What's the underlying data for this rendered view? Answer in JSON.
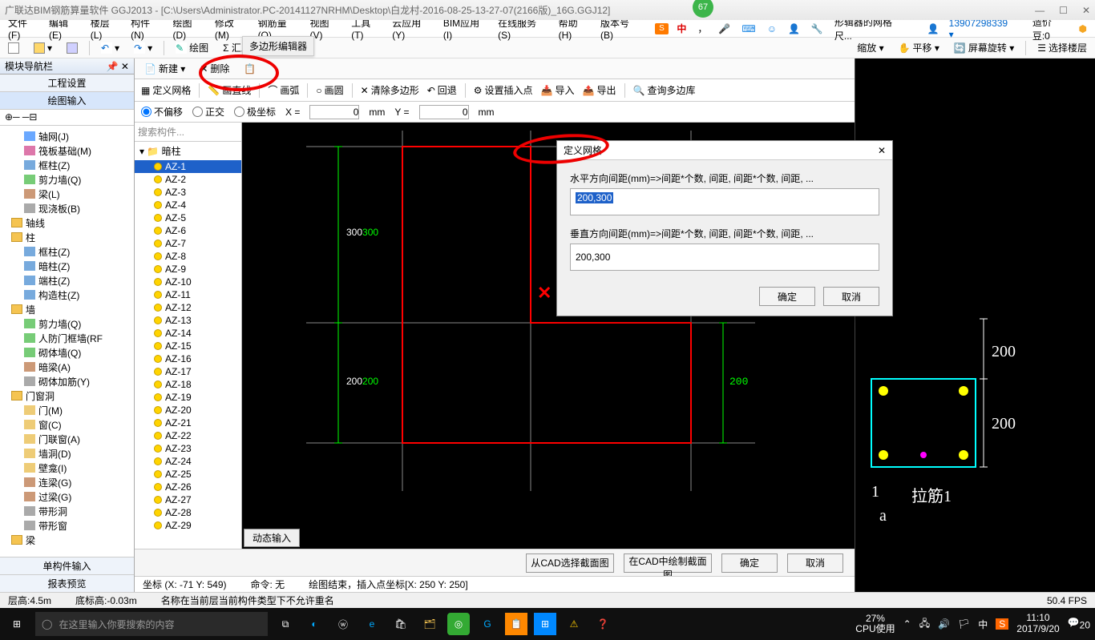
{
  "title": "广联达BIM钢筋算量软件 GGJ2013 - [C:\\Users\\Administrator.PC-20141127NRHM\\Desktop\\白龙村-2016-08-25-13-27-07(2166版)_16G.GGJ12]",
  "badge": "67",
  "winbtns": {
    "min": "—",
    "max": "☐",
    "close": "✕"
  },
  "menu": [
    "文件(F)",
    "编辑(E)",
    "楼层(L)",
    "构件(N)",
    "绘图(D)",
    "修改(M)",
    "钢筋量(Q)",
    "视图(V)",
    "工具(T)",
    "云应用(Y)",
    "BIM应用(I)",
    "在线服务(S)",
    "帮助(H)",
    "版本号(B)"
  ],
  "ime": {
    "s": "S",
    "cn": "中",
    "gridtip": "形辑器的网格尺..."
  },
  "user": "13907298339 ▾",
  "bean": "造价豆:0",
  "tb1": {
    "draw": "绘图",
    "sum": "Σ 汇总计算"
  },
  "tb1r": {
    "zoom": "缩放 ▾",
    "pan": "平移 ▾",
    "rot": "屏幕旋转 ▾",
    "sel": "选择楼层"
  },
  "nav": {
    "title": "模块导航栏",
    "seg1": "工程设置",
    "seg2": "绘图输入",
    "seg_bottom": [
      "单构件输入",
      "报表预览"
    ],
    "items": [
      {
        "t": "轴网(J)",
        "c": "ic-grid",
        "p": 2
      },
      {
        "t": "筏板基础(M)",
        "c": "ic-base",
        "p": 2
      },
      {
        "t": "框柱(Z)",
        "c": "ic-col",
        "p": 2
      },
      {
        "t": "剪力墙(Q)",
        "c": "ic-wall",
        "p": 2
      },
      {
        "t": "梁(L)",
        "c": "ic-beam",
        "p": 2
      },
      {
        "t": "现浇板(B)",
        "c": "ic-gen",
        "p": 2
      },
      {
        "t": "轴线",
        "c": "ic-folder",
        "p": 1
      },
      {
        "t": "柱",
        "c": "ic-folder",
        "p": 1
      },
      {
        "t": "框柱(Z)",
        "c": "ic-col",
        "p": 2
      },
      {
        "t": "暗柱(Z)",
        "c": "ic-col",
        "p": 2
      },
      {
        "t": "端柱(Z)",
        "c": "ic-col",
        "p": 2
      },
      {
        "t": "构造柱(Z)",
        "c": "ic-col",
        "p": 2
      },
      {
        "t": "墙",
        "c": "ic-folder",
        "p": 1
      },
      {
        "t": "剪力墙(Q)",
        "c": "ic-wall",
        "p": 2
      },
      {
        "t": "人防门框墙(RF",
        "c": "ic-wall",
        "p": 2
      },
      {
        "t": "砌体墙(Q)",
        "c": "ic-wall",
        "p": 2
      },
      {
        "t": "暗梁(A)",
        "c": "ic-beam",
        "p": 2
      },
      {
        "t": "砌体加筋(Y)",
        "c": "ic-gen",
        "p": 2
      },
      {
        "t": "门窗洞",
        "c": "ic-folder",
        "p": 1
      },
      {
        "t": "门(M)",
        "c": "ic-door",
        "p": 2
      },
      {
        "t": "窗(C)",
        "c": "ic-door",
        "p": 2
      },
      {
        "t": "门联窗(A)",
        "c": "ic-door",
        "p": 2
      },
      {
        "t": "墙洞(D)",
        "c": "ic-door",
        "p": 2
      },
      {
        "t": "壁龛(I)",
        "c": "ic-door",
        "p": 2
      },
      {
        "t": "连梁(G)",
        "c": "ic-beam",
        "p": 2
      },
      {
        "t": "过梁(G)",
        "c": "ic-beam",
        "p": 2
      },
      {
        "t": "带形洞",
        "c": "ic-gen",
        "p": 2
      },
      {
        "t": "带形窗",
        "c": "ic-gen",
        "p": 2
      },
      {
        "t": "梁",
        "c": "ic-folder",
        "p": 1
      }
    ]
  },
  "subtb": {
    "new": "新建 ▾",
    "del": "删除"
  },
  "polytitle": "多边形编辑器",
  "polytb": {
    "grid": "定义网格",
    "line": "画直线",
    "arc": "画弧",
    "circle": "画圆",
    "clear": "清除多边形",
    "back": "回退",
    "insert": "设置插入点",
    "in": "导入",
    "out": "导出",
    "query": "查询多边库"
  },
  "coord": {
    "r1": "不偏移",
    "r2": "正交",
    "r3": "极坐标",
    "xl": "X =",
    "xv": "0",
    "xm": "mm",
    "yl": "Y =",
    "yv": "0",
    "ym": "mm"
  },
  "tree2": {
    "search": "搜索构件...",
    "group": "暗柱",
    "items": [
      "AZ-1",
      "AZ-2",
      "AZ-3",
      "AZ-4",
      "AZ-5",
      "AZ-6",
      "AZ-7",
      "AZ-8",
      "AZ-9",
      "AZ-10",
      "AZ-11",
      "AZ-12",
      "AZ-13",
      "AZ-14",
      "AZ-15",
      "AZ-16",
      "AZ-17",
      "AZ-18",
      "AZ-19",
      "AZ-20",
      "AZ-21",
      "AZ-22",
      "AZ-23",
      "AZ-24",
      "AZ-25",
      "AZ-26",
      "AZ-27",
      "AZ-28",
      "AZ-29"
    ]
  },
  "canvas": {
    "dim300a": "300",
    "dim300b": "300",
    "dim200a": "200",
    "dim200b": "200",
    "dim200c": "200",
    "redx": "✕",
    "dyn": "动态输入"
  },
  "right": {
    "d200a": "200",
    "d200b": "200",
    "l1": "1",
    "l2": "拉筋1",
    "l3": "a"
  },
  "dlg": {
    "title": "定义网格",
    "close": "✕",
    "lbl1": "水平方向间距(mm)=>间距*个数, 间距, 间距*个数, 间距, ...",
    "val1": "200,300",
    "lbl2": "垂直方向间距(mm)=>间距*个数, 间距, 间距*个数, 间距, ...",
    "val2": "200,300",
    "ok": "确定",
    "cancel": "取消"
  },
  "actions": {
    "a1": "从CAD选择截面图",
    "a2": "在CAD中绘制截面图",
    "ok": "确定",
    "cancel": "取消"
  },
  "status1": {
    "coord": "坐标 (X: -71 Y: 549)",
    "cmd": "命令: 无",
    "msg": "绘图结束，插入点坐标[X: 250 Y: 250]"
  },
  "status2": {
    "floor": "层高:4.5m",
    "bot": "底标高:-0.03m",
    "err": "名称在当前层当前构件类型下不允许重名",
    "fps": "50.4 FPS"
  },
  "taskbar": {
    "search": "在这里输入你要搜索的内容",
    "cpu": "27%",
    "cpulbl": "CPU使用",
    "time": "11:10",
    "date": "2017/9/20",
    "cn": "中",
    "s": "S",
    "n": "20"
  }
}
